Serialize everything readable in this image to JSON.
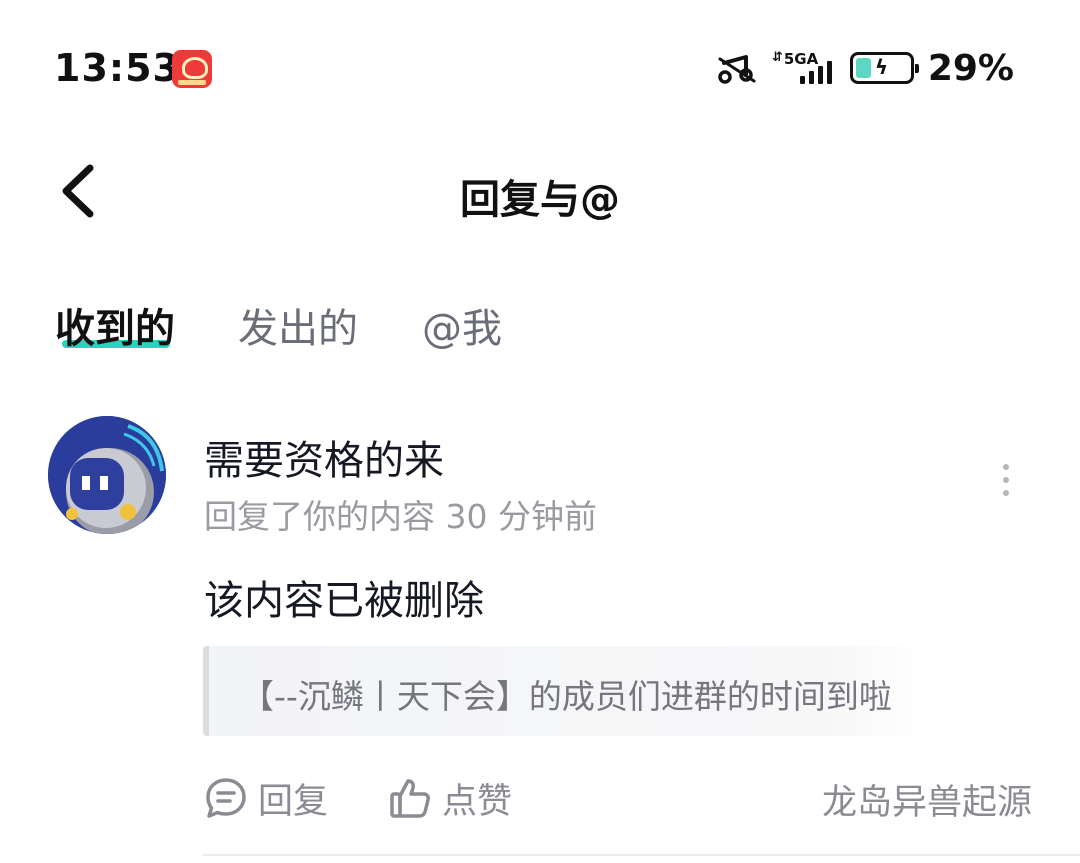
{
  "status_bar": {
    "time": "13:53",
    "network": "5GA",
    "battery_percent": "29%",
    "battery_level": 0.29,
    "battery_fill_color": "#5dd6c6",
    "icons": [
      "app-notification-icon",
      "music-icon",
      "signal-icon",
      "battery-icon"
    ]
  },
  "header": {
    "title": "回复与@",
    "back_icon": "chevron-left-icon"
  },
  "tabs": [
    {
      "label": "收到的",
      "active": true
    },
    {
      "label": "发出的",
      "active": false
    },
    {
      "label": "@我",
      "active": false
    }
  ],
  "accent_color": "#29d3c0",
  "message": {
    "sender": "需要资格的来",
    "meta": "回复了你的内容 30 分钟前",
    "text": "该内容已被删除",
    "quoted": "【--沉鳞丨天下会】的成员们进群的时间到啦",
    "actions": {
      "reply": "回复",
      "like": "点赞"
    },
    "source": "龙岛异兽起源"
  }
}
